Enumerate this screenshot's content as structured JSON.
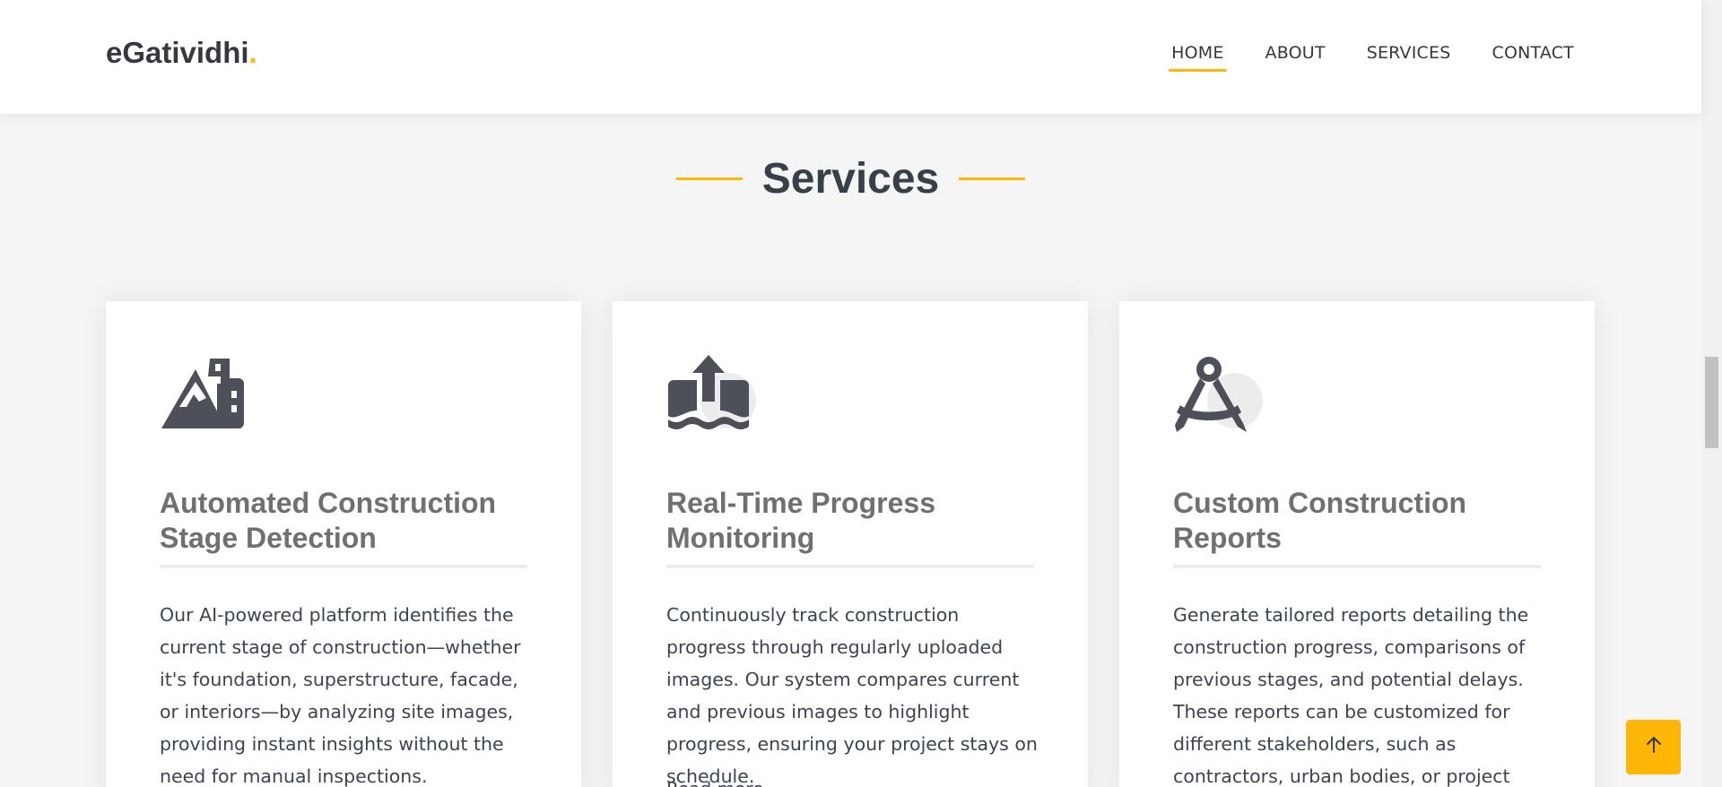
{
  "header": {
    "logo_text": "eGatividhi",
    "logo_dot": ".",
    "nav": [
      {
        "label": "HOME",
        "active": true
      },
      {
        "label": "ABOUT",
        "active": false
      },
      {
        "label": "SERVICES",
        "active": false
      },
      {
        "label": "CONTACT",
        "active": false
      }
    ]
  },
  "services": {
    "title": "Services",
    "cards": [
      {
        "icon": "mountain-city-icon",
        "title": "Automated Construction Stage Detection",
        "description": "Our AI-powered platform identifies the current stage of construction—whether it's foundation, superstructure, facade, or interiors—by analyzing site images, providing instant insights without the need for manual inspections."
      },
      {
        "icon": "upload-water-icon",
        "title": "Real-Time Progress Monitoring",
        "description": "Continuously track construction progress through regularly uploaded images. Our system compares current and previous images to highlight progress, ensuring your project stays on schedule.",
        "extra": "Read more"
      },
      {
        "icon": "compass-drafting-icon",
        "title": "Custom Construction Reports",
        "description": "Generate tailored reports detailing the construction progress, comparisons of previous stages, and potential delays. These reports can be customized for different stakeholders, such as contractors, urban bodies, or project"
      }
    ]
  },
  "colors": {
    "accent": "#ffb606",
    "heading": "#37404a",
    "card_title": "#6f6f74",
    "background": "#f4f5f4"
  },
  "back_to_top_icon": "arrow-up-icon"
}
